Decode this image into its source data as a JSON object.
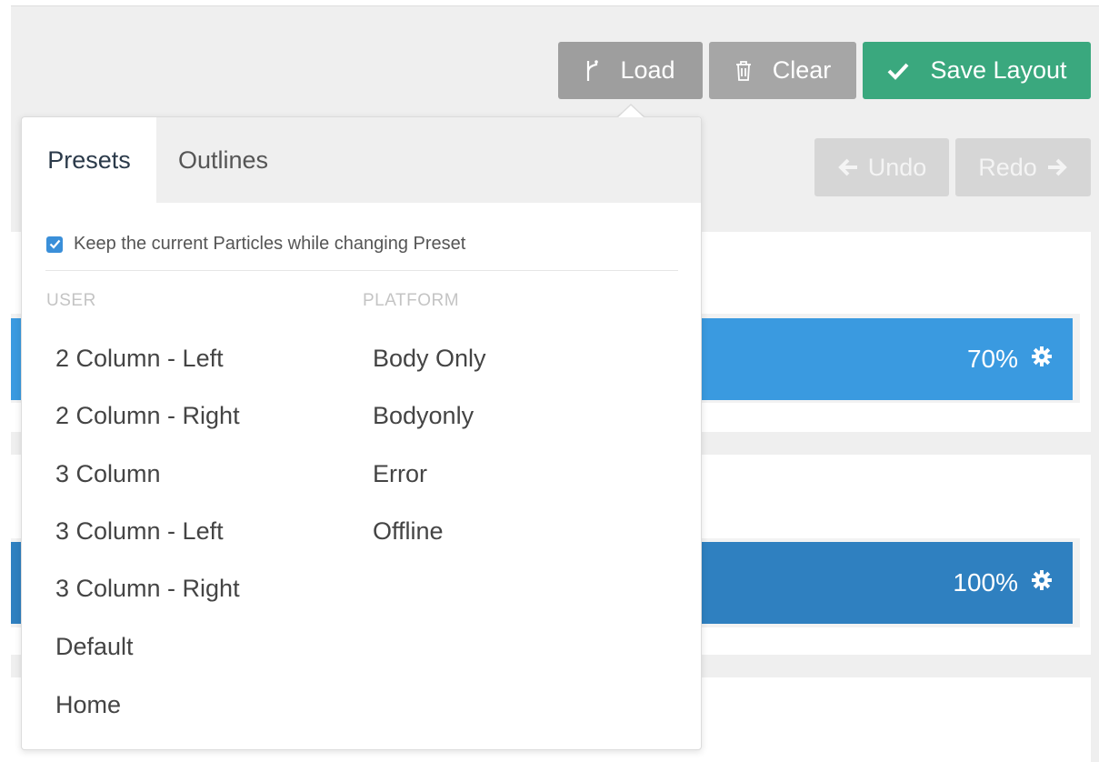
{
  "toolbar": {
    "load_label": "Load",
    "clear_label": "Clear",
    "save_label": "Save Layout",
    "undo_label": "Undo",
    "redo_label": "Redo"
  },
  "layout_bars": [
    {
      "percent": "70%"
    },
    {
      "percent": "100%"
    }
  ],
  "dropdown": {
    "tabs": [
      {
        "label": "Presets",
        "active": true
      },
      {
        "label": "Outlines",
        "active": false
      }
    ],
    "keep_particles": {
      "label": "Keep the current Particles while changing Preset",
      "checked": true
    },
    "user_heading": "USER",
    "platform_heading": "PLATFORM",
    "user_presets": [
      "2 Column - Left",
      "2 Column - Right",
      "3 Column",
      "3 Column - Left",
      "3 Column - Right",
      "Default",
      "Home"
    ],
    "platform_presets": [
      "Body Only",
      "Bodyonly",
      "Error",
      "Offline"
    ]
  },
  "colors": {
    "save": "#3aa87e",
    "bar_70": "#3a9ae0",
    "bar_100": "#2f80c0",
    "checkbox": "#3a8fd9"
  },
  "icons": [
    "fork-icon",
    "trash-icon",
    "check-icon",
    "arrow-left-icon",
    "arrow-right-icon",
    "gear-icon"
  ]
}
